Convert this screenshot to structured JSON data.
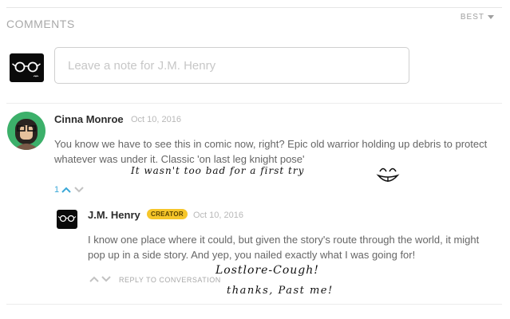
{
  "header": {
    "title": "COMMENTS",
    "sort_label": "BEST",
    "sort_icon": "chevron-down-icon"
  },
  "composer": {
    "placeholder": "Leave a note for J.M. Henry",
    "avatar_icon": "glasses-icon"
  },
  "comments": [
    {
      "author": "Cinna Monroe",
      "date": "Oct 10, 2016",
      "text": "You know we have to see this in comic now, right? Epic old warrior holding up debris to protect whatever was under it. Classic 'on last leg knight pose'",
      "votes": "1",
      "upvote_active_color": "#3aa8d8",
      "avatar_bg": "#3cb06a",
      "replies": [
        {
          "author": "J.M. Henry",
          "badge": "CREATOR",
          "badge_color": "#f6c62a",
          "date": "Oct 10, 2016",
          "text": "I know one place where it could, but given the story's route through the world, it might pop up in a side story. And yep, you nailed exactly what I was going for!",
          "reply_label": "REPLY TO CONVERSATION"
        }
      ]
    }
  ],
  "annotations": {
    "note1": "It wasn't too bad for a first try",
    "note2": "Lostlore-Cough!",
    "note3": "thanks, Past me!"
  }
}
